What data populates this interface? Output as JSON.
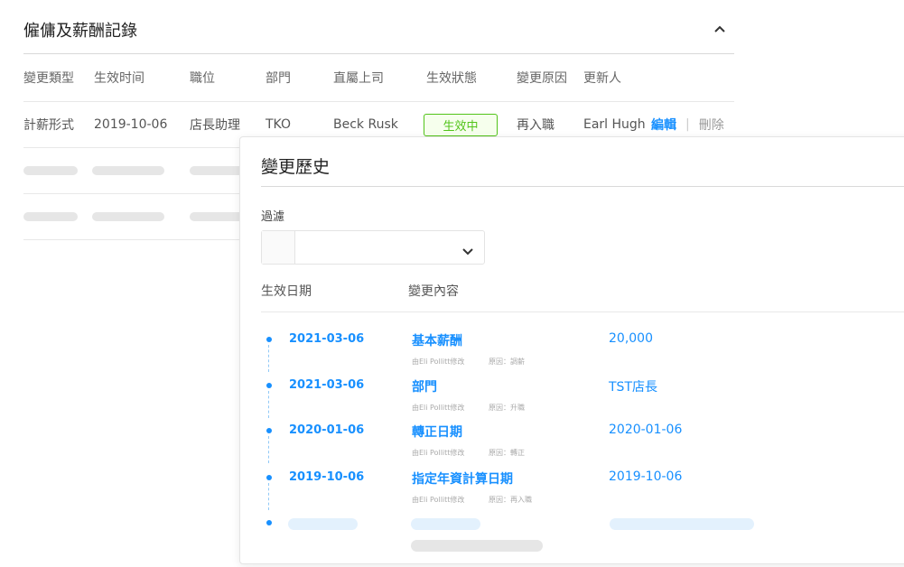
{
  "section": {
    "title": "僱傭及薪酬記錄"
  },
  "table": {
    "headers": [
      "變更類型",
      "生效时间",
      "職位",
      "部門",
      "直屬上司",
      "生效狀態",
      "變更原因",
      "更新人"
    ],
    "row": {
      "type": "計薪形式",
      "date": "2019-10-06",
      "position": "店長助理",
      "department": "TKO",
      "manager": "Beck Rusk",
      "status": "生效中",
      "reason": "再入職",
      "updater": "Earl Hugh",
      "edit_label": "編輯",
      "separator": "|",
      "delete_label": "刪除"
    }
  },
  "history": {
    "title": "變更歷史",
    "filter_label": "過濾",
    "col_date": "生效日期",
    "col_content": "變更內容",
    "items": [
      {
        "date": "2021-03-06",
        "field": "基本薪酬",
        "value": "20,000",
        "modified_by": "由Eli Pollitt修改",
        "reason": "原因：調薪"
      },
      {
        "date": "2021-03-06",
        "field": "部門",
        "value": "TST店長",
        "modified_by": "由Eli Pollitt修改",
        "reason": "原因：升職"
      },
      {
        "date": "2020-01-06",
        "field": "轉正日期",
        "value": "2020-01-06",
        "modified_by": "由Eli Pollitt修改",
        "reason": "原因：轉正"
      },
      {
        "date": "2019-10-06",
        "field": "指定年資計算日期",
        "value": "2019-10-06",
        "modified_by": "由Eli Pollitt修改",
        "reason": "原因：再入職"
      }
    ]
  },
  "colors": {
    "accent": "#1890ff",
    "status_green": "#52c41a"
  },
  "icons": {
    "collapse": "chevron-up-icon",
    "dropdown": "chevron-down-icon"
  }
}
